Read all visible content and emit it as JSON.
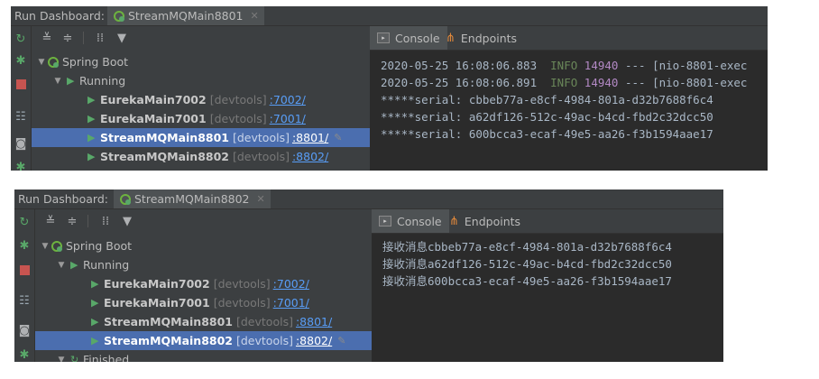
{
  "panels": [
    {
      "title_label": "Run Dashboard:",
      "run_tab": "StreamMQMain8801",
      "tree": {
        "spring_boot": "Spring Boot",
        "running": "Running",
        "items": [
          {
            "name": "EurekaMain7002",
            "tag": "[devtools]",
            "port": ":7002/"
          },
          {
            "name": "EurekaMain7001",
            "tag": "[devtools]",
            "port": ":7001/"
          },
          {
            "name": "StreamMQMain8801",
            "tag": "[devtools]",
            "port": ":8801/"
          },
          {
            "name": "StreamMQMain8802",
            "tag": "[devtools]",
            "port": ":8802/"
          }
        ]
      },
      "tabs": {
        "console": "Console",
        "endpoints": "Endpoints"
      },
      "log": [
        {
          "ts": "2020-05-25 16:08:06.883",
          "level": "INFO",
          "pid": "14940",
          "rest": "--- [nio-8801-exec"
        },
        {
          "ts": "2020-05-25 16:08:06.891",
          "level": "INFO",
          "pid": "14940",
          "rest": "--- [nio-8801-exec"
        }
      ],
      "lines": [
        "*****serial: cbbeb77a-e8cf-4984-801a-d32b7688f6c4",
        "*****serial: a62df126-512c-49ac-b4cd-fbd2c32dcc50",
        "*****serial: 600bcca3-ecaf-49e5-aa26-f3b1594aae17"
      ]
    },
    {
      "title_label": "Run Dashboard:",
      "run_tab": "StreamMQMain8802",
      "tree": {
        "spring_boot": "Spring Boot",
        "running": "Running",
        "finished": "Finished",
        "items": [
          {
            "name": "EurekaMain7002",
            "tag": "[devtools]",
            "port": ":7002/"
          },
          {
            "name": "EurekaMain7001",
            "tag": "[devtools]",
            "port": ":7001/"
          },
          {
            "name": "StreamMQMain8801",
            "tag": "[devtools]",
            "port": ":8801/"
          },
          {
            "name": "StreamMQMain8802",
            "tag": "[devtools]",
            "port": ":8802/"
          }
        ]
      },
      "tabs": {
        "console": "Console",
        "endpoints": "Endpoints"
      },
      "lines": [
        "接收消息cbbeb77a-e8cf-4984-801a-d32b7688f6c4",
        "接收消息a62df126-512c-49ac-b4cd-fbd2c32dcc50",
        "接收消息600bcca3-ecaf-49e5-aa26-f3b1594aae17"
      ]
    }
  ],
  "icons": {
    "rerun": "rerun-icon",
    "debug": "debug-bug-icon",
    "stop": "stop-icon",
    "layout": "layout-icon",
    "camera": "camera-icon",
    "expand_all": "expand-all-icon",
    "collapse_all": "collapse-all-icon",
    "group": "group-icon",
    "filter": "filter-icon"
  },
  "colors": {
    "selection": "#4b6eaf",
    "port_link": "#589df6",
    "run_green": "#59a869",
    "stop_red": "#c75450"
  }
}
